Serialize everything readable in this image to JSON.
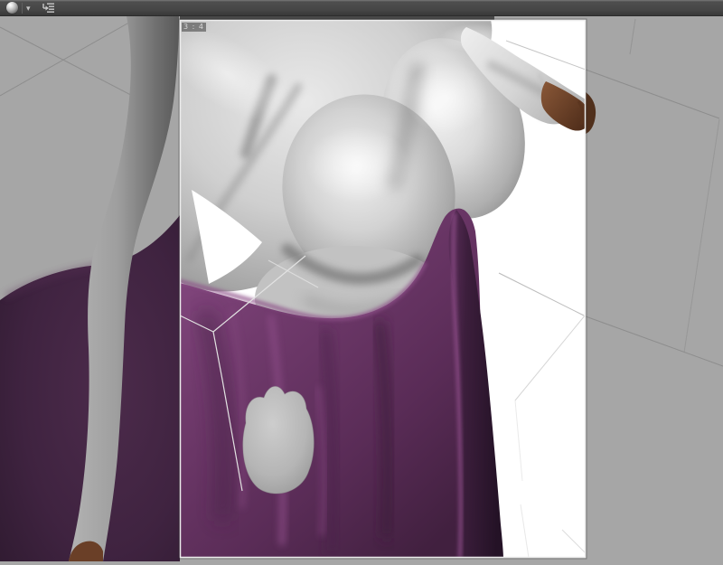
{
  "toolbar": {
    "display_mode_icon": "shaded-sphere",
    "dropdown_glyph": "▾",
    "outline_icon": "scene-outline-list"
  },
  "viewport": {
    "aspect_label": "3 : 4",
    "colors": {
      "toolbar_bg": "#464646",
      "background_gray": "#a6a6a6",
      "frame_background": "#ffffff",
      "frame_border": "#ededed",
      "figure_gray": "#c6c6c6",
      "dress_purple": "#6f3a6c",
      "dress_purple_dark": "#2e172e",
      "dress_purple_dimmed": "#3f2340",
      "skin_brown": "#7c4c30",
      "guide_line": "#8f8f8f",
      "bone_line": "#e0e0e0"
    }
  }
}
